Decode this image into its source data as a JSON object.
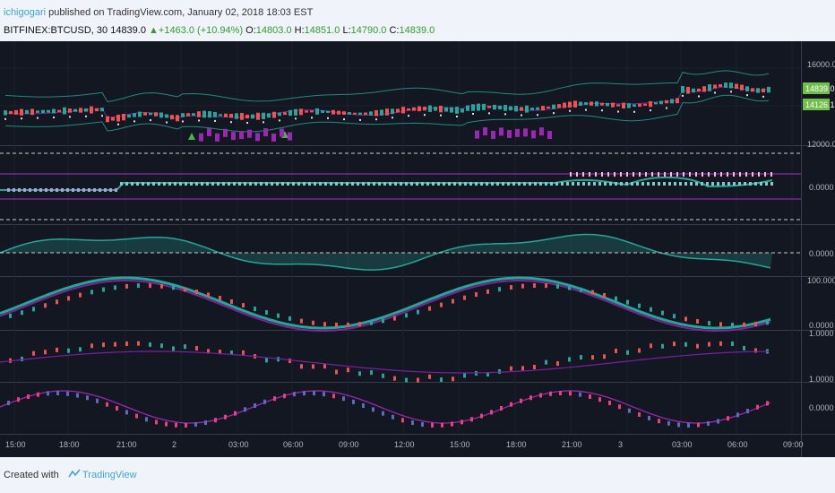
{
  "header": {
    "author": "ichigogari",
    "published_text": " published on TradingView.com, January 02, 2018 18:03 EST",
    "symbol": "BITFINEX:BTCUSD, 30",
    "last": "14839.0",
    "change": "▲+1463.0 (+10.94%)",
    "o_label": "O:",
    "o_value": "14803.0",
    "h_label": "H:",
    "h_value": "14851.0",
    "l_label": "L:",
    "l_value": "14790.0",
    "c_label": "C:",
    "c_value": "14839.0"
  },
  "price_axis": {
    "p1_top": "16000.0",
    "p1_last": "14839.0",
    "p1_mid": "14126.12",
    "p1_bottom": "12000.0",
    "p2_zero": "0.0000",
    "p3_zero": "0.0000",
    "p4_top": "100.0000",
    "p4_zero": "0.0000",
    "p5_top": "1.0000",
    "p6_top": "1.0000",
    "p6_zero": "0.0000"
  },
  "time_axis": [
    "15:00",
    "18:00",
    "21:00",
    "2",
    "03:00",
    "06:00",
    "09:00",
    "12:00",
    "15:00",
    "18:00",
    "21:00",
    "3",
    "03:00",
    "06:00",
    "09:00"
  ],
  "footer": {
    "created": "Created with",
    "brand": "TradingView"
  },
  "colors": {
    "bg": "#131722",
    "teal": "#26a69a",
    "purple": "#9c27b0",
    "up": "#4caf50",
    "down": "#ef5350",
    "axis_label_bg": "#6fbf4a"
  }
}
